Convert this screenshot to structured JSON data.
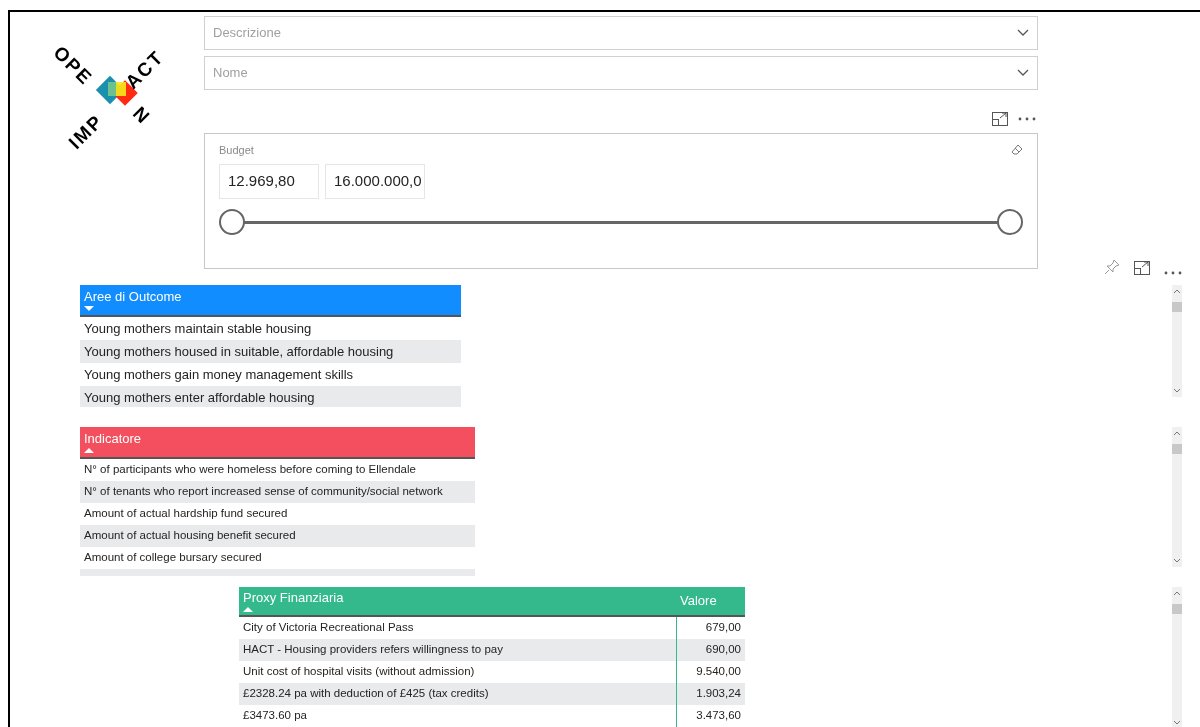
{
  "logo": {
    "parts": [
      {
        "kind": "ope",
        "text": "OPE"
      },
      {
        "kind": "n",
        "text": "N"
      },
      {
        "kind": "imp",
        "text": "IMP"
      },
      {
        "kind": "act",
        "text": "ACT"
      }
    ]
  },
  "filters": [
    {
      "placeholder": "Descrizione"
    },
    {
      "placeholder": "Nome"
    }
  ],
  "budget": {
    "label": "Budget",
    "min_value": "12.969,80",
    "max_value": "16.000.000,0",
    "thumbs": [
      {
        "level": 0
      },
      {
        "level": 1
      }
    ]
  },
  "tables": [
    {
      "kind": "outcome",
      "color": "#118dff",
      "columns": [
        {
          "label": "Aree di Outcome",
          "sorted": true,
          "descending": true
        }
      ],
      "rows": [
        [
          "Young mothers maintain stable housing"
        ],
        [
          "Young mothers housed in suitable, affordable housing"
        ],
        [
          "Young mothers gain money management skills"
        ],
        [
          "Young mothers enter affordable housing"
        ]
      ]
    },
    {
      "kind": "indicator",
      "color": "#f44f5e",
      "columns": [
        {
          "label": "Indicatore",
          "sorted": true,
          "descending": false
        }
      ],
      "rows": [
        [
          "N° of participants who were homeless before coming to Ellendale"
        ],
        [
          "N° of tenants who report increased sense of community/social network"
        ],
        [
          "Amount of actual hardship fund secured"
        ],
        [
          "Amount of actual housing benefit secured"
        ],
        [
          "Amount of college bursary secured"
        ]
      ]
    },
    {
      "kind": "proxy",
      "color": "#33b98c",
      "columns": [
        {
          "label": "Proxy Finanziaria",
          "sorted": true,
          "descending": false
        },
        {
          "label": "Valore",
          "sorted": false
        }
      ],
      "rows": [
        [
          "City of Victoria Recreational Pass",
          "679,00"
        ],
        [
          "HACT - Housing providers refers willingness to pay",
          "690,00"
        ],
        [
          "Unit cost of hospital visits (without admission)",
          "9.540,00"
        ],
        [
          "£2328.24 pa with deduction of £425 (tax credits)",
          "1.903,24"
        ],
        [
          "£3473.60 pa",
          "3.473,60"
        ]
      ]
    }
  ]
}
